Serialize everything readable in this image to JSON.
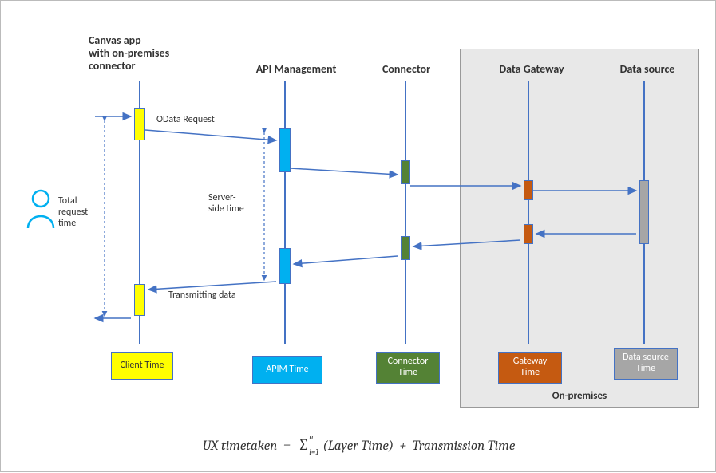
{
  "headers": {
    "canvas": "Canvas app\nwith on-premises\nconnector",
    "apim": "API Management",
    "connector": "Connector",
    "gateway": "Data Gateway",
    "datasource": "Data source"
  },
  "labels": {
    "odata": "OData Request",
    "server_side": "Server-\nside time",
    "transmitting": "Transmitting data",
    "total_request": "Total\nrequest\ntime",
    "onprem": "On-premises"
  },
  "legends": {
    "client": "Client Time",
    "apim": "APIM Time",
    "connector": "Connector\nTime",
    "gateway": "Gateway\nTime",
    "datasource": "Data source\nTime"
  },
  "formula": {
    "lhs": "UX timetaken",
    "eq": "=",
    "sum_top": "n",
    "sum_bottom": "i=1",
    "term1": "(Layer Time)",
    "plus": "+",
    "term2": "Transmission Time"
  },
  "chart_data": {
    "type": "sequence-diagram",
    "participants": [
      {
        "id": "client",
        "label": "Canvas app with on-premises connector",
        "legend": "Client Time",
        "color": "#ffff00"
      },
      {
        "id": "apim",
        "label": "API Management",
        "legend": "APIM Time",
        "color": "#00b0f0"
      },
      {
        "id": "connector",
        "label": "Connector",
        "legend": "Connector Time",
        "color": "#548235"
      },
      {
        "id": "gateway",
        "label": "Data Gateway",
        "legend": "Gateway Time",
        "color": "#c55a11",
        "group": "on-premises"
      },
      {
        "id": "datasource",
        "label": "Data source",
        "legend": "Data source Time",
        "color": "#a6a6a6",
        "group": "on-premises"
      }
    ],
    "group": {
      "id": "on-premises",
      "label": "On-premises",
      "members": [
        "gateway",
        "datasource"
      ]
    },
    "messages": [
      {
        "from": "user",
        "to": "client",
        "label": ""
      },
      {
        "from": "client",
        "to": "apim",
        "label": "OData Request"
      },
      {
        "from": "apim",
        "to": "connector",
        "label": ""
      },
      {
        "from": "connector",
        "to": "gateway",
        "label": ""
      },
      {
        "from": "gateway",
        "to": "datasource",
        "label": ""
      },
      {
        "from": "datasource",
        "to": "gateway",
        "label": ""
      },
      {
        "from": "gateway",
        "to": "connector",
        "label": ""
      },
      {
        "from": "connector",
        "to": "apim",
        "label": ""
      },
      {
        "from": "apim",
        "to": "client",
        "label": "Transmitting data"
      },
      {
        "from": "client",
        "to": "user",
        "label": ""
      }
    ],
    "spans": [
      {
        "label": "Total request time",
        "from": "client request start",
        "to": "client response end"
      },
      {
        "label": "Server-side time",
        "from": "apim request start",
        "to": "apim response end"
      }
    ],
    "formula": "UX timetaken = Σ_{i=1}^{n}(Layer Time) + Transmission Time"
  }
}
